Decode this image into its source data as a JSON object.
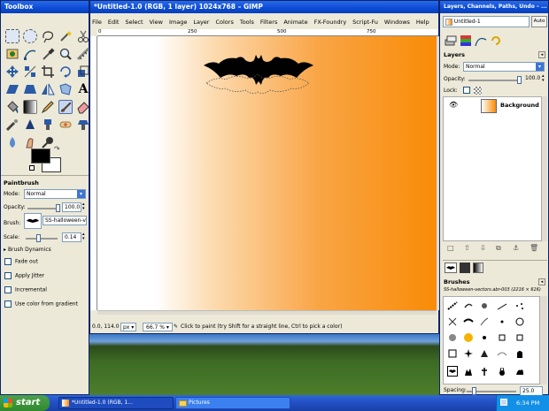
{
  "toolbox": {
    "title": "Toolbox",
    "fg_color": "#000000",
    "bg_color": "#ffffff",
    "options_title": "Paintbrush",
    "mode_label": "Mode:",
    "mode_value": "Normal",
    "opacity_label": "Opacity:",
    "opacity_value": "100.0",
    "brush_label": "Brush:",
    "brush_value": "SS-halloween-vect",
    "scale_label": "Scale:",
    "scale_value": "0.14",
    "dynamics_label": "Brush Dynamics",
    "checkboxes": [
      "Fade out",
      "Apply Jitter",
      "Incremental",
      "Use color from gradient"
    ]
  },
  "image_window": {
    "title": "*Untitled-1.0 (RGB, 1 layer) 1024x768 – GIMP",
    "menu": [
      "File",
      "Edit",
      "Select",
      "View",
      "Image",
      "Layer",
      "Colors",
      "Tools",
      "Filters",
      "Animate",
      "FX-Foundry",
      "Script-Fu",
      "Windows",
      "Help"
    ],
    "ruler_marks": [
      "0",
      "250",
      "500",
      "750"
    ],
    "coords": "0.0, 114.0",
    "unit": "px",
    "zoom": "66.7 %",
    "status": "Click to paint (try Shift for a straight line, Ctrl to pick a color)",
    "gradient_color": "#f98b06"
  },
  "dock": {
    "title": "Layers, Channels, Paths, Undo – ...",
    "image_select": "Untitled-1",
    "auto_label": "Auto",
    "layers_title": "Layers",
    "mode_label": "Mode:",
    "mode_value": "Normal",
    "opacity_label": "Opacity:",
    "opacity_value": "100.0",
    "lock_label": "Lock:",
    "layer_name": "Background",
    "brushes_title": "Brushes",
    "brush_name": "SS-halloween-vectors.abr-003 (2216 × 616)",
    "spacing_label": "Spacing:",
    "spacing_value": "25.0"
  },
  "taskbar": {
    "start_label": "start",
    "tasks": [
      "*Untitled-1.0 (RGB, 1...",
      "Pictures"
    ],
    "clock": "6:34 PM"
  }
}
